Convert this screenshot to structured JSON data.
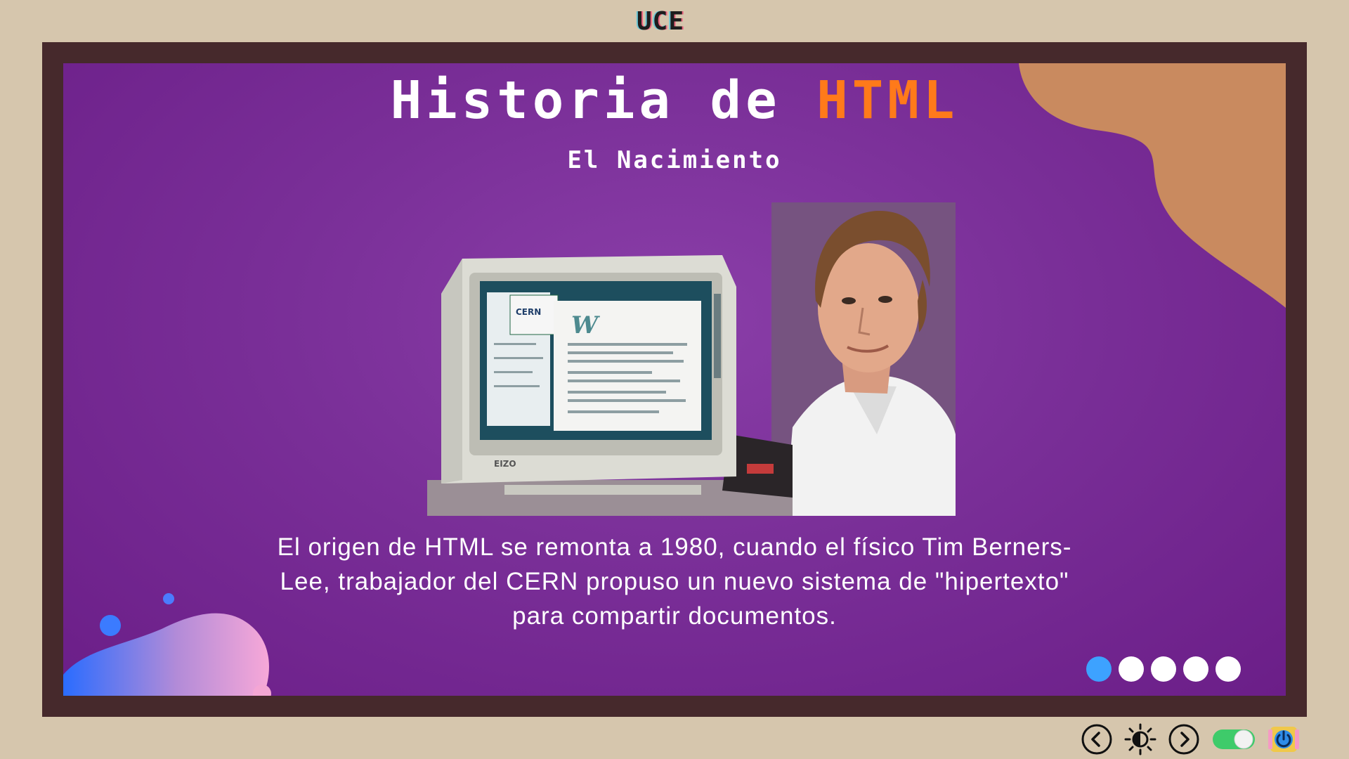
{
  "brand": "UCE",
  "slide": {
    "title_main": "Historia de",
    "title_accent": "HTML",
    "subtitle": "El Nacimiento",
    "body_lines": [
      "El origen de HTML se remonta a 1980, cuando el físico Tim Berners-",
      "Lee, trabajador del CERN propuso un nuevo sistema de \"hipertexto\"",
      "para compartir documentos."
    ],
    "photo_screen_logo": "CERN",
    "photo_monitor_brand": "EIZO"
  },
  "pagination": {
    "total": 5,
    "active": 1
  },
  "controls": {
    "icons": [
      "chevron-left-icon",
      "brightness-icon",
      "chevron-right-icon",
      "toggle-switch",
      "power-icon"
    ],
    "toggle_on": true
  },
  "colors": {
    "page_bg": "#d6c6ad",
    "frame": "#46292c",
    "slide_bg": "#7a2f98",
    "accent_orange": "#ff7a1a",
    "blob_orange": "#c98a5f",
    "dot_active": "#3da2ff",
    "toggle_on": "#3ecb6a"
  }
}
